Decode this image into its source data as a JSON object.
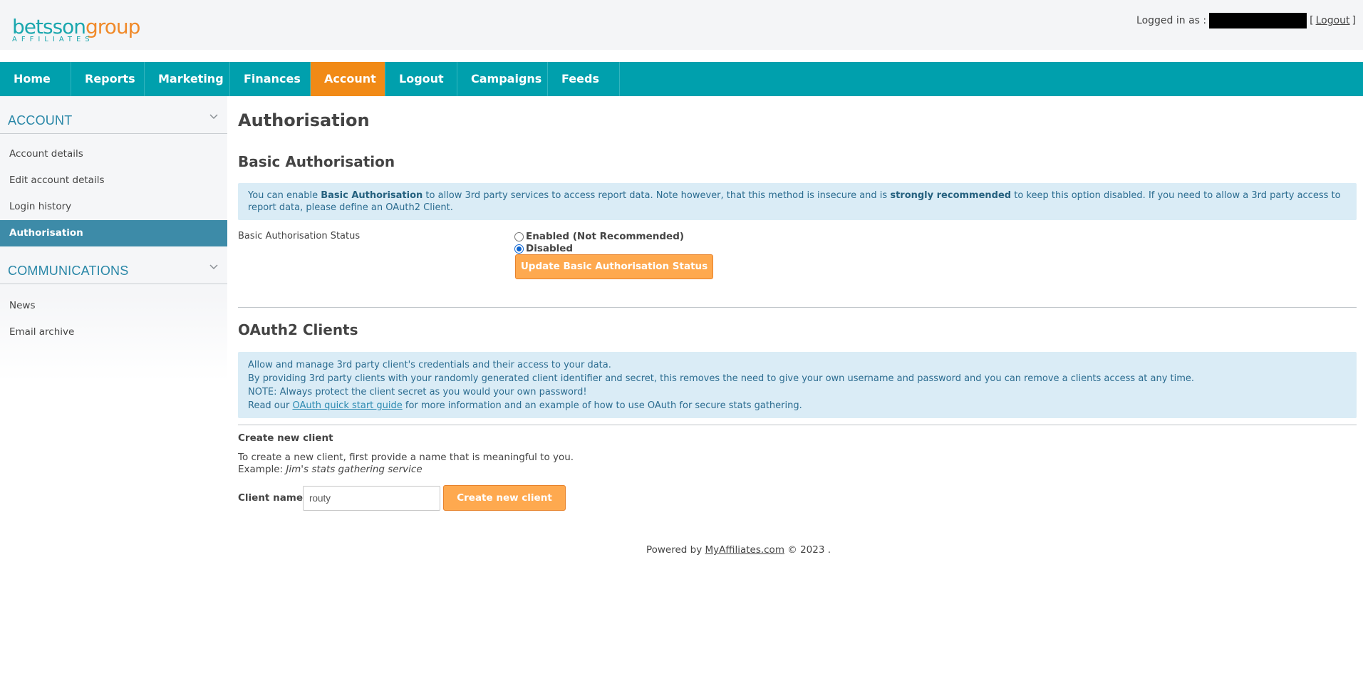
{
  "header": {
    "logo_text_part1": "betsson",
    "logo_text_part2": "group",
    "logo_subtext": "AFFILIATES",
    "logged_in_label": "Logged in as :",
    "logout_open": "[",
    "logout_link": "Logout",
    "logout_close": "]"
  },
  "nav": {
    "items": [
      {
        "label": "Home"
      },
      {
        "label": "Reports"
      },
      {
        "label": "Marketing"
      },
      {
        "label": "Finances"
      },
      {
        "label": "Account"
      },
      {
        "label": "Logout"
      },
      {
        "label": "Campaigns"
      },
      {
        "label": "Feeds"
      }
    ],
    "active": "Account"
  },
  "sidebar": {
    "sections": [
      {
        "title": "ACCOUNT",
        "items": [
          {
            "label": "Account details"
          },
          {
            "label": "Edit account details"
          },
          {
            "label": "Login history"
          },
          {
            "label": "Authorisation"
          }
        ]
      },
      {
        "title": "COMMUNICATIONS",
        "items": [
          {
            "label": "News"
          },
          {
            "label": "Email archive"
          }
        ]
      }
    ],
    "active_item": "Authorisation"
  },
  "main": {
    "title": "Authorisation",
    "basic": {
      "heading": "Basic Authorisation",
      "info_1": "You can enable ",
      "info_bold_1": "Basic Authorisation",
      "info_2": " to allow 3rd party services to access report data. Note however, that this method is insecure and is ",
      "info_bold_2": "strongly recommended",
      "info_3": " to keep this option disabled. If you need to allow a 3rd party access to report data, please define an OAuth2 Client.",
      "status_label": "Basic Authorisation Status",
      "option_enabled": "Enabled (Not Recommended)",
      "option_disabled": "Disabled",
      "selected": "Disabled",
      "update_button": "Update Basic Authorisation Status"
    },
    "oauth": {
      "heading": "OAuth2 Clients",
      "line1": "Allow and manage 3rd party client's credentials and their access to your data.",
      "line2": "By providing 3rd party clients with your randomly generated client identifier and secret, this removes the need to give your own username and password and you can remove a clients access at any time.",
      "line3": "NOTE: Always protect the client secret as you would your own password!",
      "line4_pre": "Read our ",
      "line4_link": "OAuth quick start guide",
      "line4_post": " for more information and an example of how to use OAuth for secure stats gathering.",
      "create_heading": "Create new client",
      "create_desc": "To create a new client, first provide a name that is meaningful to you.",
      "example_label": "Example: ",
      "example_value": "Jim's stats gathering service",
      "client_name_label": "Client name:",
      "client_name_value": "routy",
      "create_button": "Create new client"
    }
  },
  "footer": {
    "powered_by": "Powered by ",
    "link": "MyAffiliates.com",
    "copyright": " © 2023 ."
  },
  "colors": {
    "teal": "#00a0ad",
    "orange_active": "#f18a16",
    "button_orange": "#fea94f",
    "sidebar_active": "#3d8ba8",
    "info_bg": "#daecf6"
  }
}
